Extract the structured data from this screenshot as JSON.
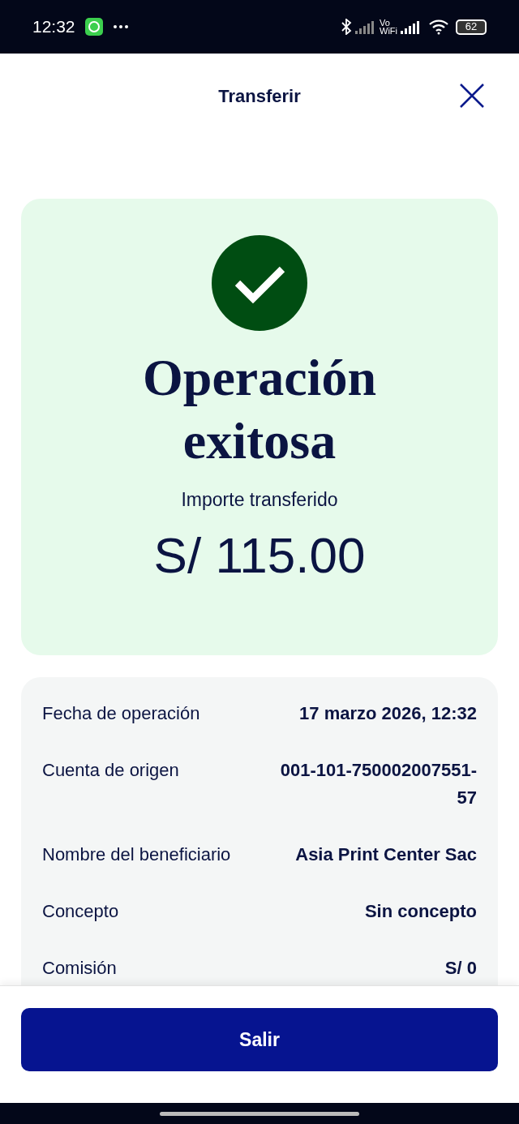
{
  "status_bar": {
    "time": "12:32",
    "battery": "62",
    "wifi_label_top": "Vo",
    "wifi_label_bottom": "WiFi"
  },
  "header": {
    "title": "Transferir"
  },
  "result": {
    "title": "Operación exitosa",
    "subtitle": "Importe transferido",
    "amount": "S/ 115.00"
  },
  "details": [
    {
      "label": "Fecha de operación",
      "value": "17 marzo 2026, 12:32"
    },
    {
      "label": "Cuenta de origen",
      "value": "001-101-750002007551-57"
    },
    {
      "label": "Nombre del beneficiario",
      "value": "Asia Print Center Sac"
    },
    {
      "label": "Concepto",
      "value": "Sin concepto"
    },
    {
      "label": "Comisión",
      "value": "S/ 0"
    }
  ],
  "primary_button": {
    "label": "Salir"
  }
}
